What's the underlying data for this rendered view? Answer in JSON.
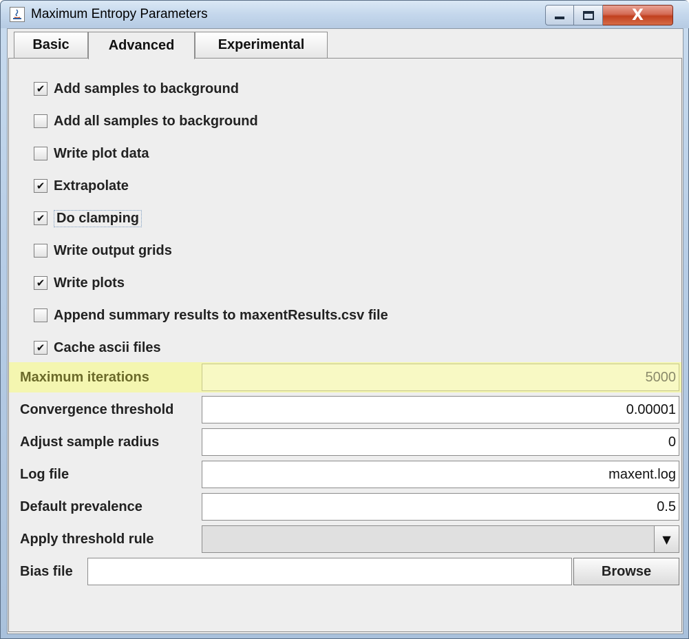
{
  "window": {
    "title": "Maximum Entropy Parameters",
    "close_glyph": "X"
  },
  "tabs": [
    {
      "label": "Basic",
      "active": false
    },
    {
      "label": "Advanced",
      "active": true
    },
    {
      "label": "Experimental",
      "active": false
    }
  ],
  "checkboxes": [
    {
      "label": "Add samples to background",
      "checked": true
    },
    {
      "label": "Add all samples to background",
      "checked": false
    },
    {
      "label": "Write plot data",
      "checked": false
    },
    {
      "label": "Extrapolate",
      "checked": true
    },
    {
      "label": "Do clamping",
      "checked": true
    },
    {
      "label": "Write output grids",
      "checked": false
    },
    {
      "label": "Write plots",
      "checked": true
    },
    {
      "label": "Append summary results to maxentResults.csv file",
      "checked": false
    },
    {
      "label": "Cache ascii files",
      "checked": true
    }
  ],
  "params": {
    "max_iterations": {
      "label": "Maximum iterations",
      "value": "5000"
    },
    "convergence": {
      "label": "Convergence threshold",
      "value": "0.00001"
    },
    "sample_radius": {
      "label": "Adjust sample radius",
      "value": "0"
    },
    "log_file": {
      "label": "Log file",
      "value": "maxent.log"
    },
    "prevalence": {
      "label": "Default prevalence",
      "value": "0.5"
    },
    "threshold_rule": {
      "label": "Apply threshold rule",
      "value": ""
    },
    "bias_file": {
      "label": "Bias file",
      "value": "",
      "browse_label": "Browse"
    }
  },
  "colors": {
    "highlight": "#f4f6b0",
    "panel": "#eeeeee",
    "close_button": "#c1401f"
  }
}
